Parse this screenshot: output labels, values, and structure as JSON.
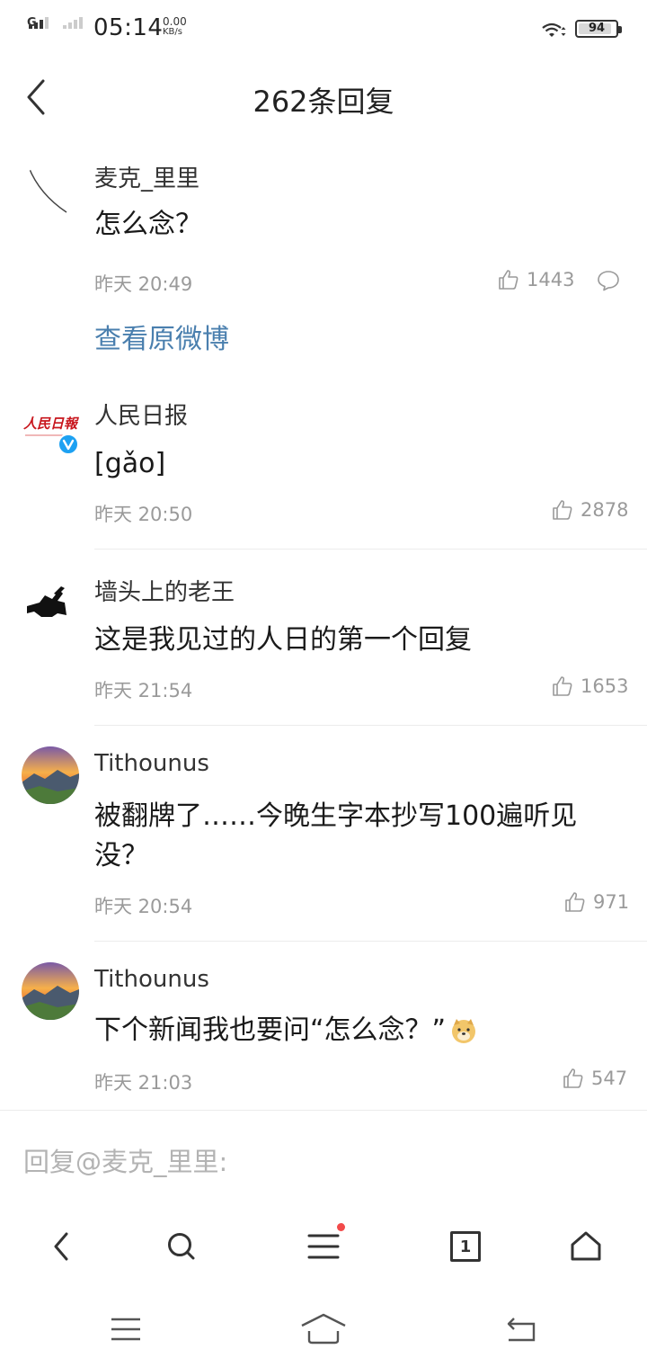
{
  "status_bar": {
    "network": "G",
    "time": "05:14",
    "speed_value": "0.00",
    "speed_unit": "KB/s",
    "battery": "94"
  },
  "header": {
    "title": "262条回复"
  },
  "original_comment": {
    "username": "麦克_里里",
    "content": "怎么念？",
    "time": "昨天 20:49",
    "likes": "1443"
  },
  "view_original_label": "查看原微博",
  "replies": [
    {
      "username": "人民日报",
      "content": "[gǎo]",
      "time": "昨天 20:50",
      "likes": "2878"
    },
    {
      "username": "墙头上的老王",
      "content": "这是我见过的人日的第一个回复",
      "time": "昨天 21:54",
      "likes": "1653"
    },
    {
      "username": "Tithounus",
      "content": "被翻牌了……今晚生字本抄写100遍听见没？",
      "time": "昨天 20:54",
      "likes": "971"
    },
    {
      "username": "Tithounus",
      "content": "下个新闻我也要问“怎么念？”",
      "time": "昨天 21:03",
      "likes": "547"
    }
  ],
  "avatar_logo_text": "人民日報",
  "reply_input": {
    "placeholder": "回复@麦克_里里:"
  },
  "toolbar": {
    "tabs_count": "1"
  },
  "colors": {
    "link": "#4a7fae",
    "secondary_text": "#9a9a9a",
    "badge": "#f24a4a",
    "verified": "#1da1f2"
  },
  "icons": [
    "back-icon",
    "like-icon",
    "comment-icon",
    "verified-icon",
    "doge-emoji-icon",
    "search-icon",
    "menu-icon",
    "tabs-icon",
    "home-icon",
    "recent-apps-icon",
    "sys-home-icon",
    "sys-back-icon"
  ]
}
